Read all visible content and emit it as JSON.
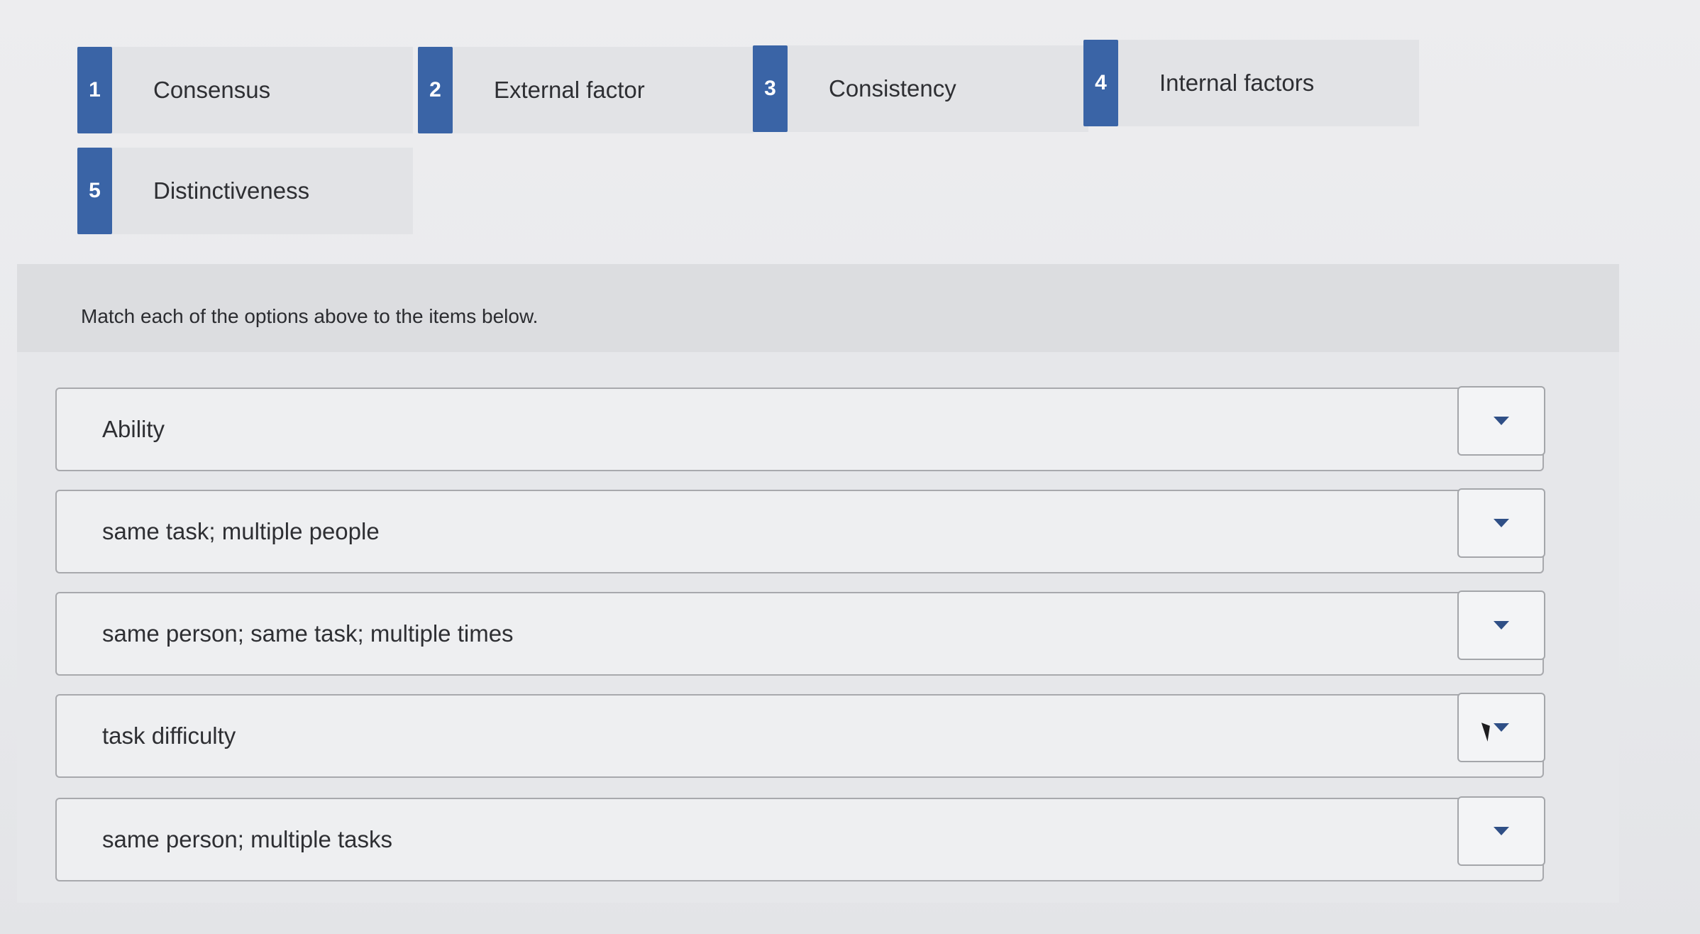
{
  "options": [
    {
      "number": "1",
      "label": "Consensus"
    },
    {
      "number": "2",
      "label": "External factor"
    },
    {
      "number": "3",
      "label": "Consistency"
    },
    {
      "number": "4",
      "label": "Internal factors"
    },
    {
      "number": "5",
      "label": "Distinctiveness"
    }
  ],
  "instruction": "Match each of the options above to the items below.",
  "items": [
    {
      "label": "Ability",
      "selected": ""
    },
    {
      "label": "same task; multiple people",
      "selected": ""
    },
    {
      "label": "same person; same task; multiple times",
      "selected": ""
    },
    {
      "label": "task difficulty",
      "selected": ""
    },
    {
      "label": "same person; multiple tasks",
      "selected": ""
    }
  ],
  "colors": {
    "accent": "#3a64a6",
    "caret": "#2f4f86"
  },
  "icons": {
    "dropdown": "chevron-down-icon",
    "cursor": "mouse-pointer-icon"
  }
}
